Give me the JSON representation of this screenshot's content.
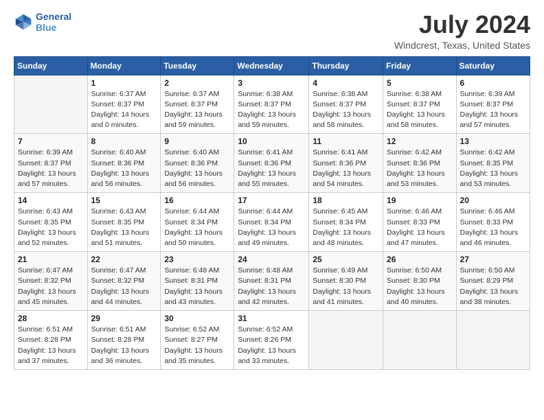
{
  "header": {
    "logo_line1": "General",
    "logo_line2": "Blue",
    "title": "July 2024",
    "subtitle": "Windcrest, Texas, United States"
  },
  "calendar": {
    "days_of_week": [
      "Sunday",
      "Monday",
      "Tuesday",
      "Wednesday",
      "Thursday",
      "Friday",
      "Saturday"
    ],
    "weeks": [
      [
        {
          "day": "",
          "info": ""
        },
        {
          "day": "1",
          "info": "Sunrise: 6:37 AM\nSunset: 8:37 PM\nDaylight: 14 hours\nand 0 minutes."
        },
        {
          "day": "2",
          "info": "Sunrise: 6:37 AM\nSunset: 8:37 PM\nDaylight: 13 hours\nand 59 minutes."
        },
        {
          "day": "3",
          "info": "Sunrise: 6:38 AM\nSunset: 8:37 PM\nDaylight: 13 hours\nand 59 minutes."
        },
        {
          "day": "4",
          "info": "Sunrise: 6:38 AM\nSunset: 8:37 PM\nDaylight: 13 hours\nand 58 minutes."
        },
        {
          "day": "5",
          "info": "Sunrise: 6:38 AM\nSunset: 8:37 PM\nDaylight: 13 hours\nand 58 minutes."
        },
        {
          "day": "6",
          "info": "Sunrise: 6:39 AM\nSunset: 8:37 PM\nDaylight: 13 hours\nand 57 minutes."
        }
      ],
      [
        {
          "day": "7",
          "info": "Sunrise: 6:39 AM\nSunset: 8:37 PM\nDaylight: 13 hours\nand 57 minutes."
        },
        {
          "day": "8",
          "info": "Sunrise: 6:40 AM\nSunset: 8:36 PM\nDaylight: 13 hours\nand 56 minutes."
        },
        {
          "day": "9",
          "info": "Sunrise: 6:40 AM\nSunset: 8:36 PM\nDaylight: 13 hours\nand 56 minutes."
        },
        {
          "day": "10",
          "info": "Sunrise: 6:41 AM\nSunset: 8:36 PM\nDaylight: 13 hours\nand 55 minutes."
        },
        {
          "day": "11",
          "info": "Sunrise: 6:41 AM\nSunset: 8:36 PM\nDaylight: 13 hours\nand 54 minutes."
        },
        {
          "day": "12",
          "info": "Sunrise: 6:42 AM\nSunset: 8:36 PM\nDaylight: 13 hours\nand 53 minutes."
        },
        {
          "day": "13",
          "info": "Sunrise: 6:42 AM\nSunset: 8:35 PM\nDaylight: 13 hours\nand 53 minutes."
        }
      ],
      [
        {
          "day": "14",
          "info": "Sunrise: 6:43 AM\nSunset: 8:35 PM\nDaylight: 13 hours\nand 52 minutes."
        },
        {
          "day": "15",
          "info": "Sunrise: 6:43 AM\nSunset: 8:35 PM\nDaylight: 13 hours\nand 51 minutes."
        },
        {
          "day": "16",
          "info": "Sunrise: 6:44 AM\nSunset: 8:34 PM\nDaylight: 13 hours\nand 50 minutes."
        },
        {
          "day": "17",
          "info": "Sunrise: 6:44 AM\nSunset: 8:34 PM\nDaylight: 13 hours\nand 49 minutes."
        },
        {
          "day": "18",
          "info": "Sunrise: 6:45 AM\nSunset: 8:34 PM\nDaylight: 13 hours\nand 48 minutes."
        },
        {
          "day": "19",
          "info": "Sunrise: 6:46 AM\nSunset: 8:33 PM\nDaylight: 13 hours\nand 47 minutes."
        },
        {
          "day": "20",
          "info": "Sunrise: 6:46 AM\nSunset: 8:33 PM\nDaylight: 13 hours\nand 46 minutes."
        }
      ],
      [
        {
          "day": "21",
          "info": "Sunrise: 6:47 AM\nSunset: 8:32 PM\nDaylight: 13 hours\nand 45 minutes."
        },
        {
          "day": "22",
          "info": "Sunrise: 6:47 AM\nSunset: 8:32 PM\nDaylight: 13 hours\nand 44 minutes."
        },
        {
          "day": "23",
          "info": "Sunrise: 6:48 AM\nSunset: 8:31 PM\nDaylight: 13 hours\nand 43 minutes."
        },
        {
          "day": "24",
          "info": "Sunrise: 6:48 AM\nSunset: 8:31 PM\nDaylight: 13 hours\nand 42 minutes."
        },
        {
          "day": "25",
          "info": "Sunrise: 6:49 AM\nSunset: 8:30 PM\nDaylight: 13 hours\nand 41 minutes."
        },
        {
          "day": "26",
          "info": "Sunrise: 6:50 AM\nSunset: 8:30 PM\nDaylight: 13 hours\nand 40 minutes."
        },
        {
          "day": "27",
          "info": "Sunrise: 6:50 AM\nSunset: 8:29 PM\nDaylight: 13 hours\nand 38 minutes."
        }
      ],
      [
        {
          "day": "28",
          "info": "Sunrise: 6:51 AM\nSunset: 8:28 PM\nDaylight: 13 hours\nand 37 minutes."
        },
        {
          "day": "29",
          "info": "Sunrise: 6:51 AM\nSunset: 8:28 PM\nDaylight: 13 hours\nand 36 minutes."
        },
        {
          "day": "30",
          "info": "Sunrise: 6:52 AM\nSunset: 8:27 PM\nDaylight: 13 hours\nand 35 minutes."
        },
        {
          "day": "31",
          "info": "Sunrise: 6:52 AM\nSunset: 8:26 PM\nDaylight: 13 hours\nand 33 minutes."
        },
        {
          "day": "",
          "info": ""
        },
        {
          "day": "",
          "info": ""
        },
        {
          "day": "",
          "info": ""
        }
      ]
    ]
  }
}
